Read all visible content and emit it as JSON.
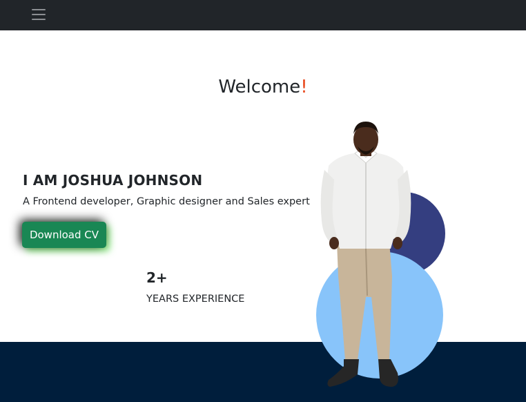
{
  "nav": {
    "menu_icon": "hamburger-menu-icon"
  },
  "hero": {
    "welcome_text": "Welcome",
    "welcome_mark": "!",
    "name": "I AM JOSHUA JOHNSON",
    "tagline": "A Frontend developer, Graphic designer and Sales expert",
    "cv_button_label": "Download CV",
    "portrait_icon": "person-portrait"
  },
  "stats": {
    "value": "2+",
    "label": "YEARS EXPERIENCE"
  },
  "colors": {
    "navbar": "#212529",
    "accent": "#e8471c",
    "button": "#198754",
    "circle_dark": "#343e80",
    "circle_light": "#88c4fa",
    "footer": "#001e3c"
  }
}
